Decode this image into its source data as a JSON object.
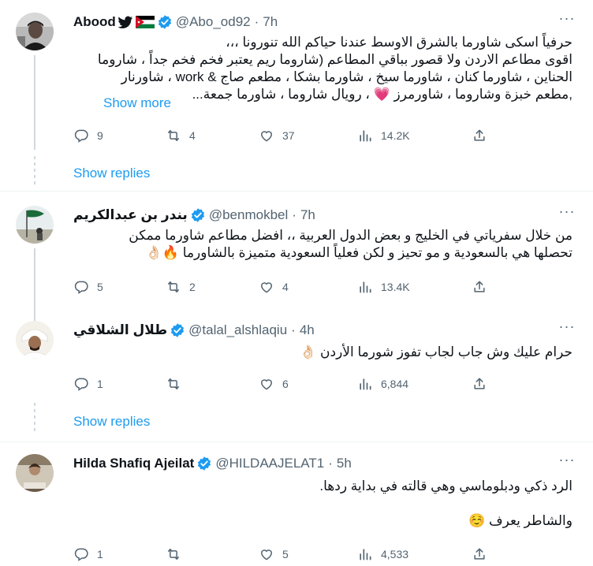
{
  "tweets": [
    {
      "name": "Abood",
      "handle": "@Abo_od92",
      "time": "7h",
      "lines": [
        "حرفياً اسكى شاورما بالشرق الاوسط عندنا حياكم الله تنورونا ،،،",
        "اقوى مطاعم الاردن ولا قصور بباقي المطاعم (شاروما ريم يعتبر فخم فخم جداً ، شاروما",
        "الحناين ، شاورما كنان ، شاورما سيخ ، شاورما بشكا ، مطعم صاج & work ، شاورنار",
        ",مطعم خبزة وشاروما ، شاورمرز 💗 ، رويال شاروما ، شاورما جمعة..."
      ],
      "show_more": "Show more",
      "replies": "9",
      "reposts": "4",
      "likes": "37",
      "views": "14.2K",
      "show_replies": "Show replies"
    },
    {
      "name": "بندر بن عبدالكريم",
      "handle": "@benmokbel",
      "time": "7h",
      "lines": [
        "من خلال سفرياتي في الخليج و بعض الدول العربية ،، افضل مطاعم شاورما ممكن",
        "تحصلها هي بالسعودية و مو تحيز و لكن فعلياً السعودية متميزة بالشاورما 🔥👌🏻"
      ],
      "replies": "5",
      "reposts": "2",
      "likes": "4",
      "views": "13.4K"
    },
    {
      "name": "طلال الشلاقي",
      "handle": "@talal_alshlaqiu",
      "time": "4h",
      "lines": [
        "حرام عليك وش جاب لجاب تفوز شورما الأردن 👌🏻"
      ],
      "replies": "1",
      "reposts": "",
      "likes": "6",
      "views": "6,844",
      "show_replies": "Show replies"
    },
    {
      "name": "Hilda Shafiq Ajeilat",
      "handle": "@HILDAAJELAT1",
      "time": "5h",
      "lines": [
        "الرد ذكي ودبلوماسي وهي قالته في بداية ردها.",
        "والشاطر يعرف ☺️"
      ],
      "replies": "1",
      "reposts": "",
      "likes": "5",
      "views": "4,533"
    }
  ],
  "colors": {
    "accent": "#1d9bf0",
    "muted": "#536471",
    "text": "#0f1419",
    "divider": "#eff3f4"
  },
  "icons": [
    "reply-icon",
    "repost-icon",
    "like-icon",
    "views-icon",
    "share-icon",
    "verified-icon",
    "more-icon"
  ]
}
